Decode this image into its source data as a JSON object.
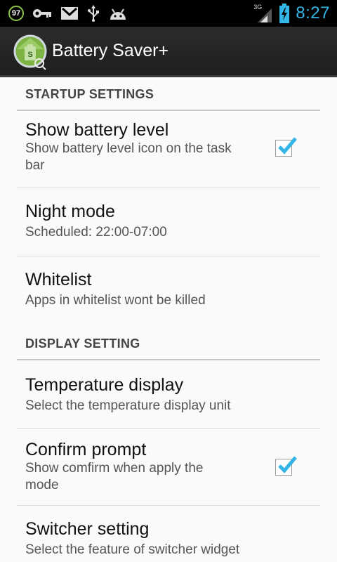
{
  "status_bar": {
    "badge": "97",
    "network": "3G",
    "time": "8:27",
    "icons": [
      "badge-97-icon",
      "key-icon",
      "gmail-icon",
      "usb-icon",
      "android-debug-icon",
      "signal-icon",
      "battery-charging-icon"
    ],
    "accent_color": "#33b5e5"
  },
  "action_bar": {
    "title": "Battery Saver+",
    "icon": "battery-saver-app-icon"
  },
  "preferences": {
    "startup_header": "STARTUP SETTINGS",
    "show_battery": {
      "title": "Show battery level",
      "summary": "Show battery level icon on the task bar",
      "checked": true
    },
    "night_mode": {
      "title": "Night mode",
      "summary": "Scheduled: 22:00-07:00"
    },
    "whitelist": {
      "title": "Whitelist",
      "summary": "Apps in whitelist wont be killed"
    },
    "display_header": "DISPLAY SETTING",
    "temperature": {
      "title": "Temperature display",
      "summary": "Select the temperature display unit"
    },
    "confirm_prompt": {
      "title": "Confirm prompt",
      "summary": "Show comfirm when apply the mode",
      "checked": true
    },
    "switcher": {
      "title": "Switcher setting",
      "summary": "Select the feature of switcher widget"
    }
  }
}
